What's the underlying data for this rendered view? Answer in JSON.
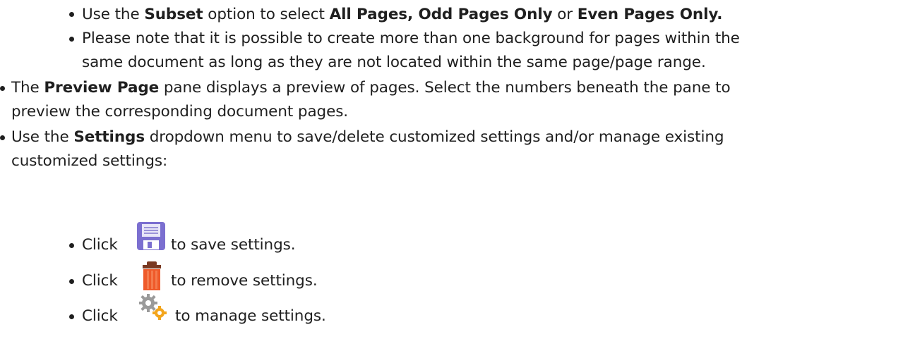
{
  "bullets": {
    "subset": {
      "prefix": "Use the ",
      "b1": "Subset",
      "mid1": " option to select ",
      "b2": "All Pages, Odd Pages Only",
      "mid2": " or ",
      "b3": "Even Pages Only."
    },
    "note": {
      "line1": "Please note that it is possible to create more than one background for pages within the",
      "line2": "same document as long as they are not located within the same page/page range."
    },
    "preview": {
      "prefix": "The ",
      "bold": "Preview Page",
      "rest": " pane displays a preview of pages. Select the numbers beneath the pane to",
      "line2": "preview the corresponding document pages."
    },
    "settings": {
      "prefix": "Use the ",
      "bold": "Settings",
      "rest": " dropdown menu to save/delete customized settings and/or manage existing",
      "line2": "customized settings:"
    },
    "save": {
      "click": "Click",
      "rest": "to save settings.",
      "icon": "floppy-disk-icon"
    },
    "remove": {
      "click": "Click",
      "rest": "to remove settings.",
      "icon": "trash-can-icon"
    },
    "manage": {
      "click": "Click",
      "rest": "to manage settings.",
      "icon": "gears-icon"
    }
  },
  "colors": {
    "text": "#1f1f1f",
    "floppy": "#7b6fd0",
    "trash": "#ef5a2a",
    "gear_gray": "#9a9a9a",
    "gear_orange": "#f3a51c"
  }
}
